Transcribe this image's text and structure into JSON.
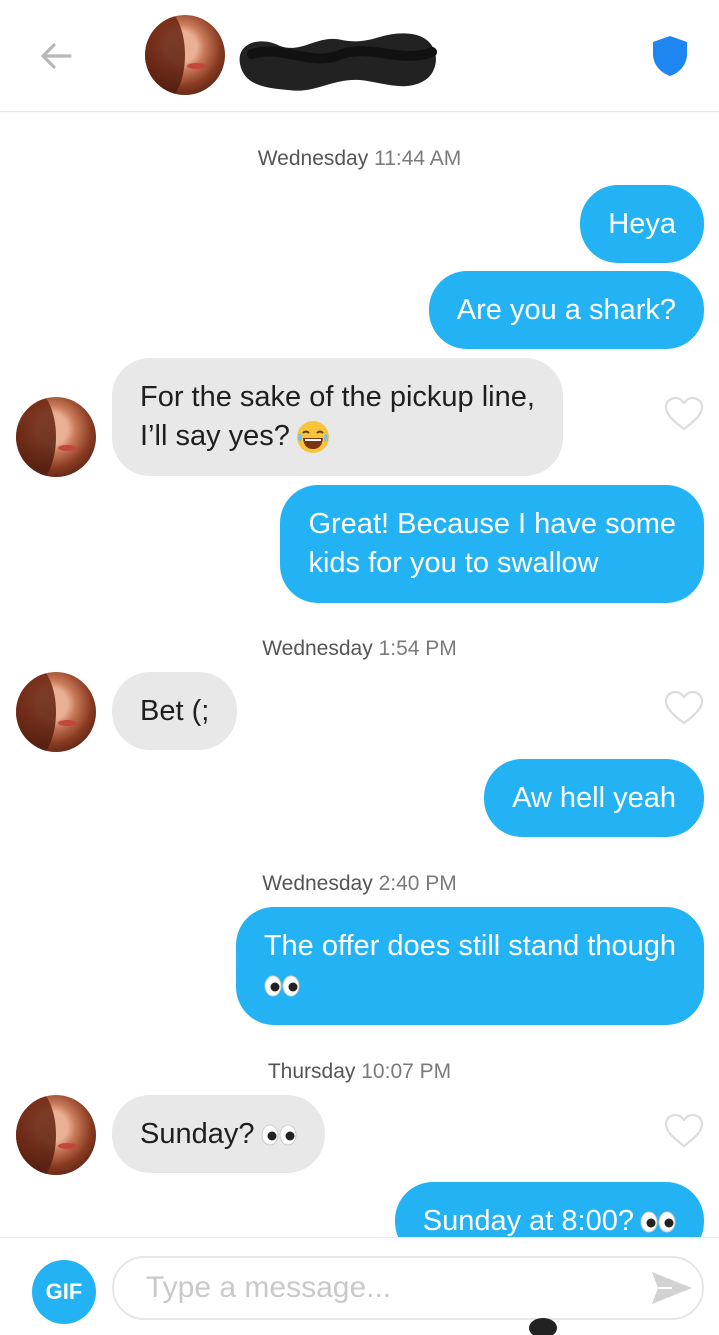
{
  "colors": {
    "accent": "#23b3f4",
    "received_bubble": "#e8e8e8",
    "timestamp": "#7b7b7b",
    "shield": "#1e86f0"
  },
  "header": {
    "back_icon": "back-arrow-icon",
    "shield_icon": "shield-icon"
  },
  "messages": {
    "ts1": {
      "day": "Wednesday",
      "time": "11:44 AM"
    },
    "m1": "Heya",
    "m2": "Are you a shark?",
    "m3_l1": "For the sake of the pickup line,",
    "m3_l2": "I’ll say yes?",
    "m4_l1": "Great! Because I have some",
    "m4_l2": "kids for you to swallow",
    "ts2": {
      "day": "Wednesday",
      "time": "1:54 PM"
    },
    "m5": "Bet (;",
    "m6": "Aw hell yeah",
    "ts3": {
      "day": "Wednesday",
      "time": "2:40 PM"
    },
    "m7": "The offer does still stand though",
    "ts4": {
      "day": "Thursday",
      "time": "10:07 PM"
    },
    "m8": "Sunday?",
    "m9": "Sunday at 8:00?"
  },
  "composer": {
    "gif_label": "GIF",
    "placeholder": "Type a message...",
    "send_icon": "send-icon"
  }
}
